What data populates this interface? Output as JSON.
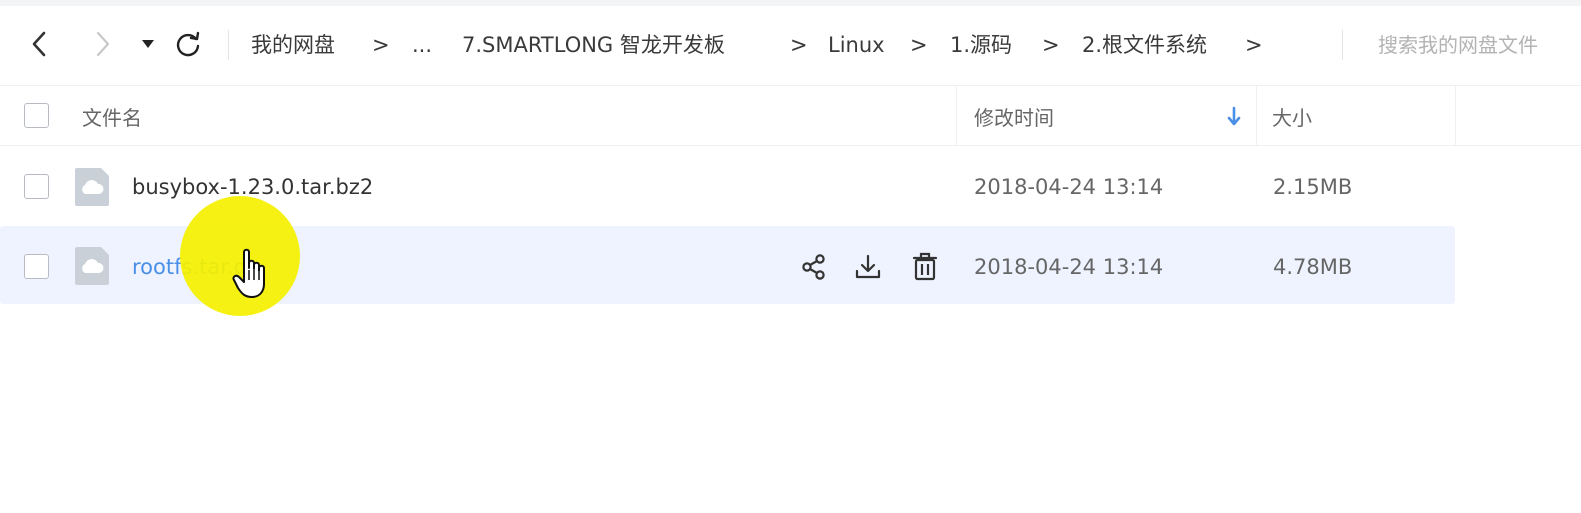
{
  "toolbar": {
    "back_icon": "chevron-left-icon",
    "forward_icon": "chevron-right-icon",
    "dropdown_icon": "caret-down-icon",
    "refresh_icon": "refresh-icon",
    "breadcrumbs": [
      "我的网盘",
      "...",
      "7.SMARTLONG 智龙开发板",
      "Linux",
      "1.源码",
      "2.根文件系统"
    ],
    "crumb_separator": ">",
    "search_placeholder": "搜索我的网盘文件"
  },
  "table": {
    "headers": {
      "name": "文件名",
      "modified": "修改时间",
      "size": "大小"
    },
    "sort_icon": "arrow-down-icon",
    "rows": [
      {
        "name": "busybox-1.23.0.tar.bz2",
        "modified": "2018-04-24 13:14",
        "size": "2.15MB",
        "icon": "cloud-file-icon",
        "hovered": false
      },
      {
        "name": "rootfs.tar.gz",
        "modified": "2018-04-24 13:14",
        "size": "4.78MB",
        "icon": "cloud-file-icon",
        "hovered": true
      }
    ],
    "row_actions": [
      "share-icon",
      "download-icon",
      "delete-icon"
    ]
  },
  "colors": {
    "accent": "#4a8fe7",
    "hover_row": "#eef3ff",
    "cursor_highlight": "#f5f000"
  }
}
